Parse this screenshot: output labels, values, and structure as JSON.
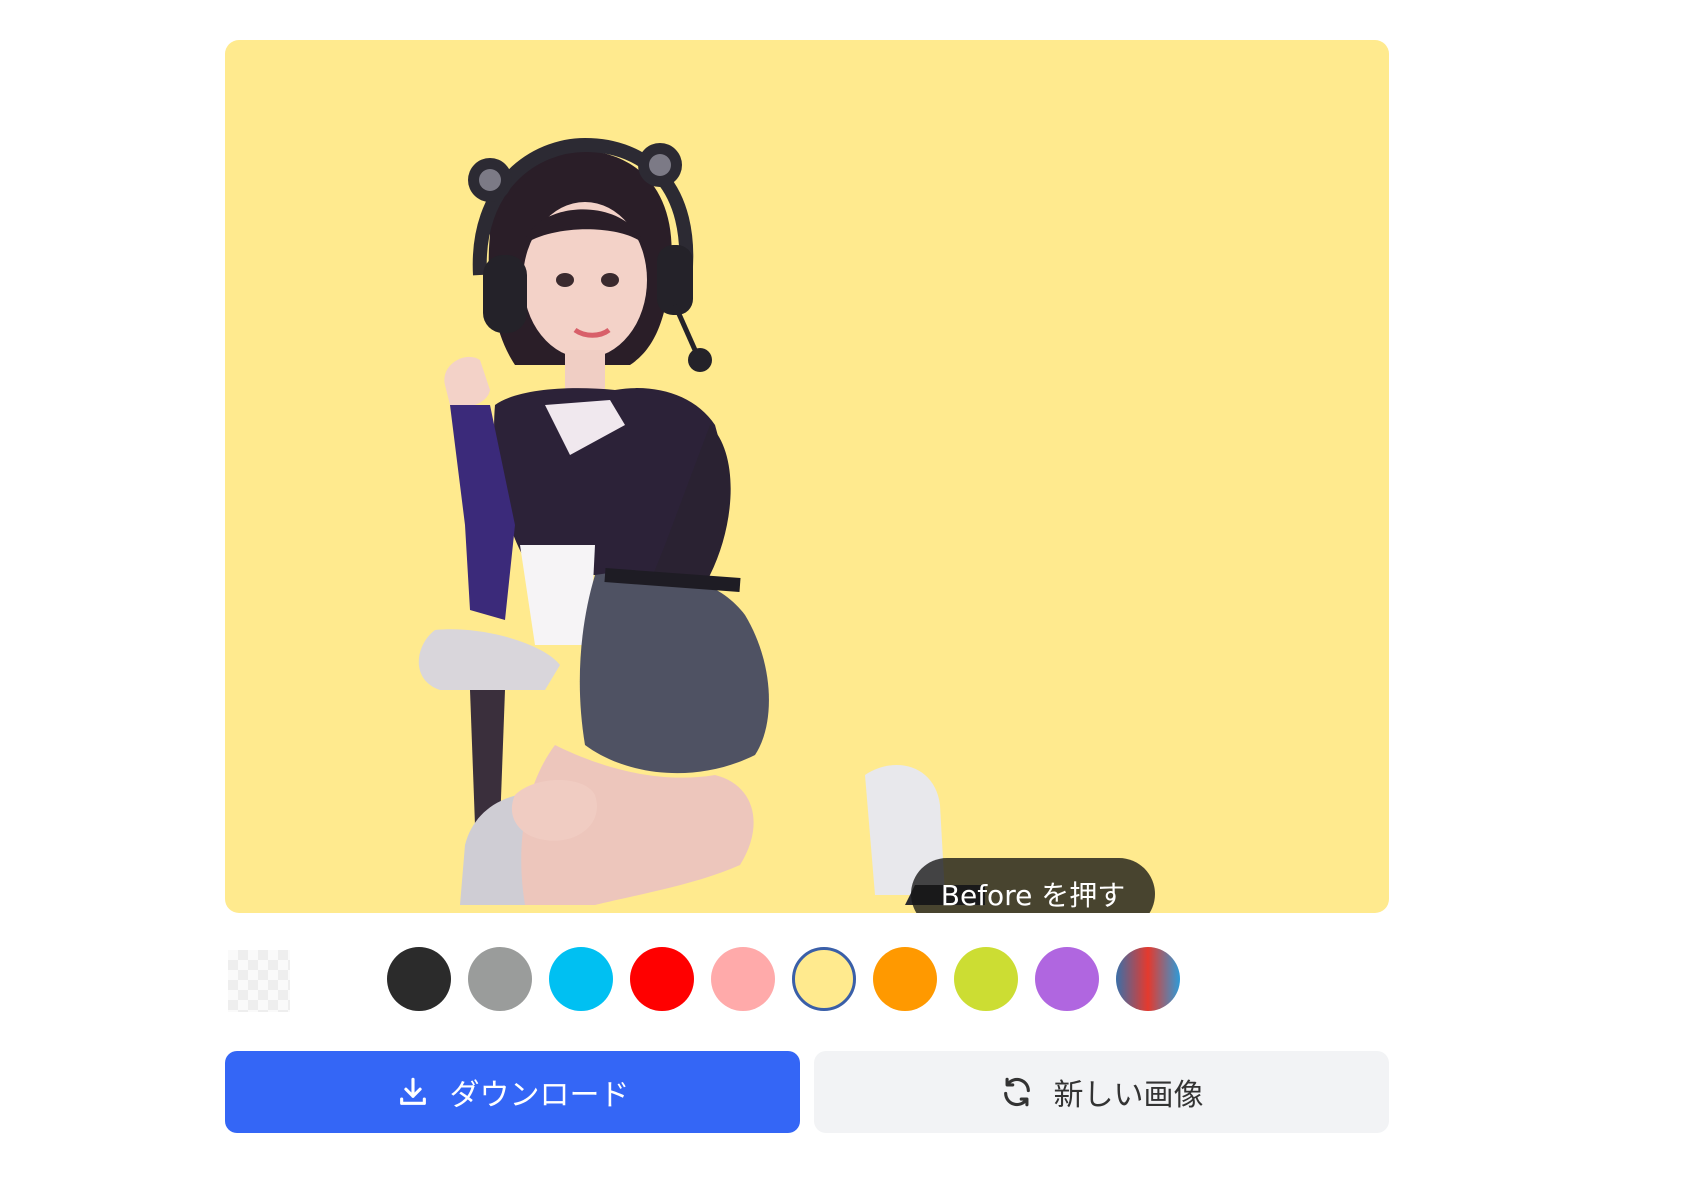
{
  "preview": {
    "background_color": "#FFEA8E",
    "before_label": "Before を押す"
  },
  "background_options": [
    {
      "name": "transparent",
      "color": "transparent",
      "selected": false
    },
    {
      "name": "black",
      "color": "#2B2B2B",
      "selected": false
    },
    {
      "name": "gray",
      "color": "#9A9C9B",
      "selected": false
    },
    {
      "name": "cyan",
      "color": "#00C0F2",
      "selected": false
    },
    {
      "name": "red",
      "color": "#FF0000",
      "selected": false
    },
    {
      "name": "pink",
      "color": "#FFAAAA",
      "selected": false
    },
    {
      "name": "yellow",
      "color": "#FFEA8E",
      "selected": true
    },
    {
      "name": "orange",
      "color": "#FF9900",
      "selected": false
    },
    {
      "name": "lime",
      "color": "#CCDD33",
      "selected": false
    },
    {
      "name": "purple",
      "color": "#B066E0",
      "selected": false
    },
    {
      "name": "gradient",
      "color": "linear-gradient(90deg,#3B6FA8,#E43A2E,#2E9BD8)",
      "selected": false
    }
  ],
  "actions": {
    "download_label": "ダウンロード",
    "download_icon": "download-icon",
    "new_image_label": "新しい画像",
    "new_image_icon": "refresh-icon",
    "primary_color": "#3466F6"
  }
}
